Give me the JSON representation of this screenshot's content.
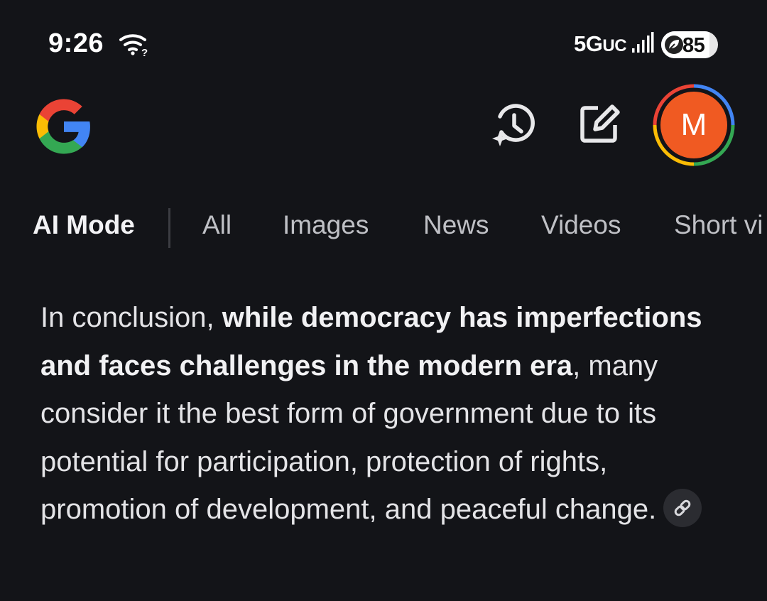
{
  "status_bar": {
    "time": "9:26",
    "network_main": "5G",
    "network_sub": "UC",
    "battery_level": "85",
    "battery_fraction": 0.85,
    "icons": [
      "wifi-icon",
      "signal-icon",
      "battery-saver-leaf-icon"
    ]
  },
  "header": {
    "logo": "google-g-logo",
    "history_icon": "history-sparkle-icon",
    "edit_icon": "edit-note-icon",
    "avatar_initial": "M",
    "avatar_color": "#f05a22"
  },
  "tabs": [
    {
      "label": "AI Mode",
      "active": true
    },
    {
      "label": "All",
      "active": false
    },
    {
      "label": "Images",
      "active": false
    },
    {
      "label": "News",
      "active": false
    },
    {
      "label": "Videos",
      "active": false
    },
    {
      "label": "Short vi",
      "active": false
    }
  ],
  "answer": {
    "intro": "In conclusion, ",
    "bold": "while democracy has imperfections and faces challenges in the modern era",
    "rest": ", many consider it the best form of government due to its potential for participation, protection of rights, promotion of development, and peaceful change.",
    "link_icon": "link-icon"
  },
  "colors": {
    "background": "#131418",
    "text": "#e4e4e7",
    "tab_inactive": "#bfc0c5",
    "avatar": "#f05a22"
  }
}
